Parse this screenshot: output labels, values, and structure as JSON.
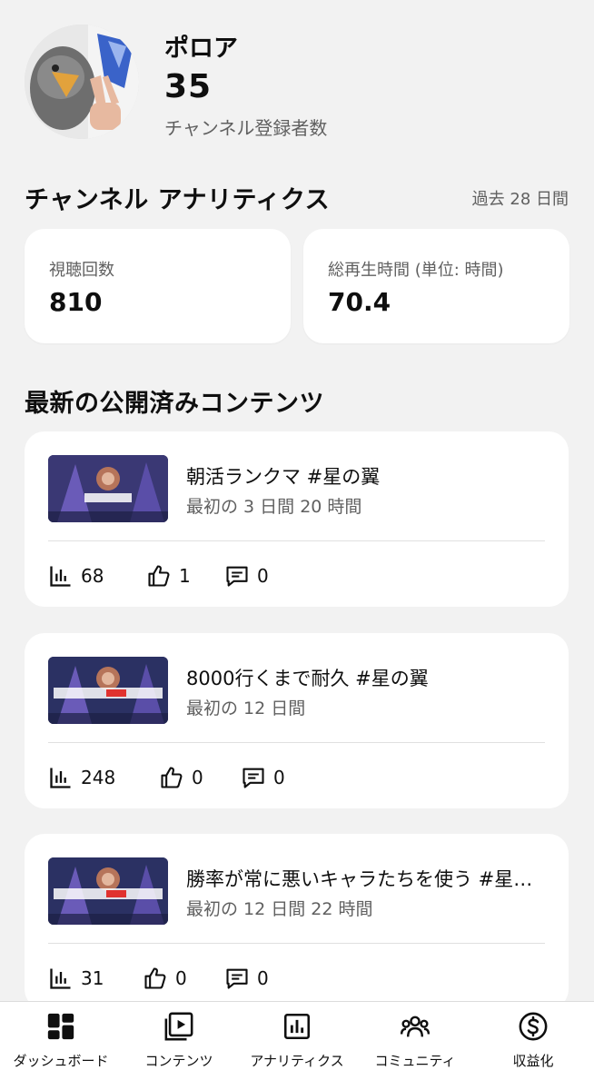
{
  "channel": {
    "name": "ポロア",
    "subscriber_count": "35",
    "subscriber_label": "チャンネル登録者数"
  },
  "analytics": {
    "title": "チャンネル アナリティクス",
    "period": "過去 28 日間",
    "stats": [
      {
        "label": "視聴回数",
        "value": "810"
      },
      {
        "label": "総再生時間 (単位: 時間)",
        "value": "70.4"
      }
    ]
  },
  "latest": {
    "title": "最新の公開済みコンテンツ",
    "videos": [
      {
        "title": "朝活ランクマ #星の翼",
        "subtitle": "最初の 3 日間 20 時間",
        "views": "68",
        "likes": "1",
        "comments": "0"
      },
      {
        "title": "8000行くまで耐久 #星の翼",
        "subtitle": "最初の 12 日間",
        "views": "248",
        "likes": "0",
        "comments": "0"
      },
      {
        "title": "勝率が常に悪いキャラたちを使う #星…",
        "subtitle": "最初の 12 日間 22 時間",
        "views": "31",
        "likes": "0",
        "comments": "0"
      }
    ]
  },
  "nav": {
    "items": [
      {
        "label": "ダッシュボード",
        "icon": "dashboard-icon"
      },
      {
        "label": "コンテンツ",
        "icon": "content-icon"
      },
      {
        "label": "アナリティクス",
        "icon": "analytics-icon"
      },
      {
        "label": "コミュニティ",
        "icon": "community-icon"
      },
      {
        "label": "収益化",
        "icon": "monetization-icon"
      }
    ]
  }
}
